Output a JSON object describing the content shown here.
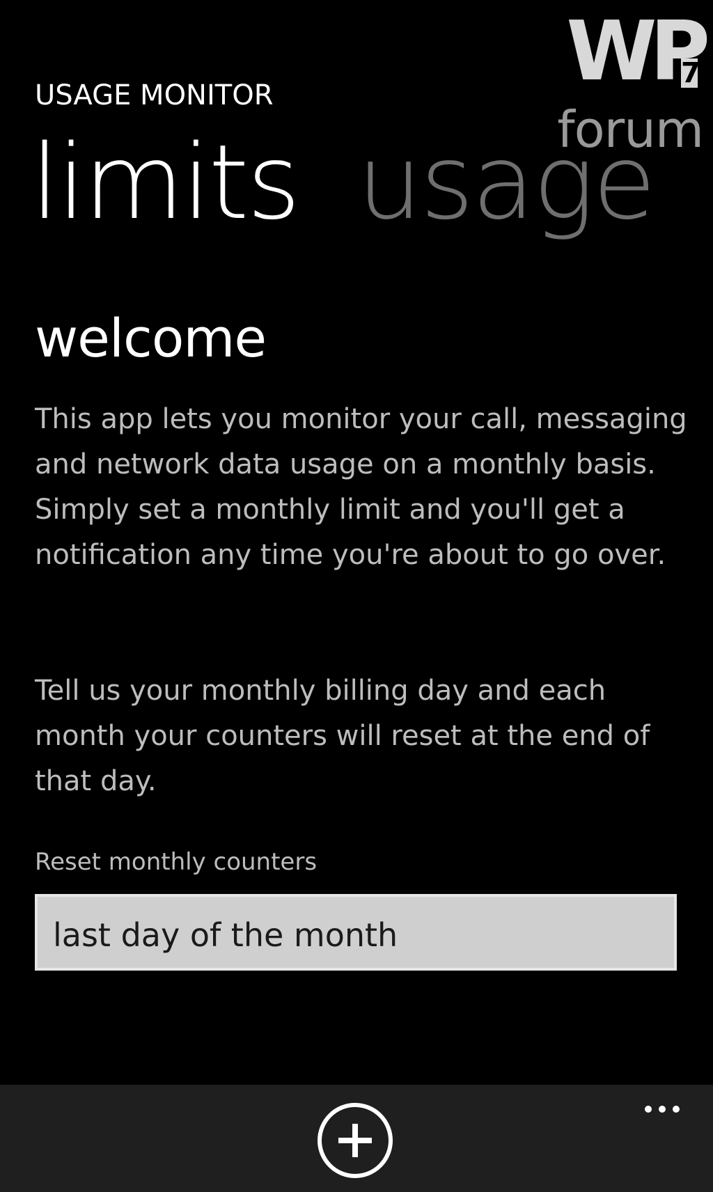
{
  "header": {
    "app_title": "USAGE MONITOR",
    "pivot_items": [
      {
        "label": "limits",
        "active": true
      },
      {
        "label": "usage",
        "active": false
      }
    ]
  },
  "watermark": {
    "logo_text": "WP",
    "logo_number": "7",
    "forum_text": "forum"
  },
  "main": {
    "heading": "welcome",
    "paragraph_1": "This app lets you monitor your call, messaging and network data usage on a monthly basis. Simply set a monthly limit and you'll get a notification any time you're about to go over.",
    "paragraph_2": "Tell us your monthly billing day and each month your counters will reset at the end of that day.",
    "reset_label": "Reset monthly counters",
    "reset_value": "last day of the month"
  },
  "app_bar": {
    "add_icon": "plus-circle-icon",
    "more_icon": "ellipsis-icon"
  }
}
